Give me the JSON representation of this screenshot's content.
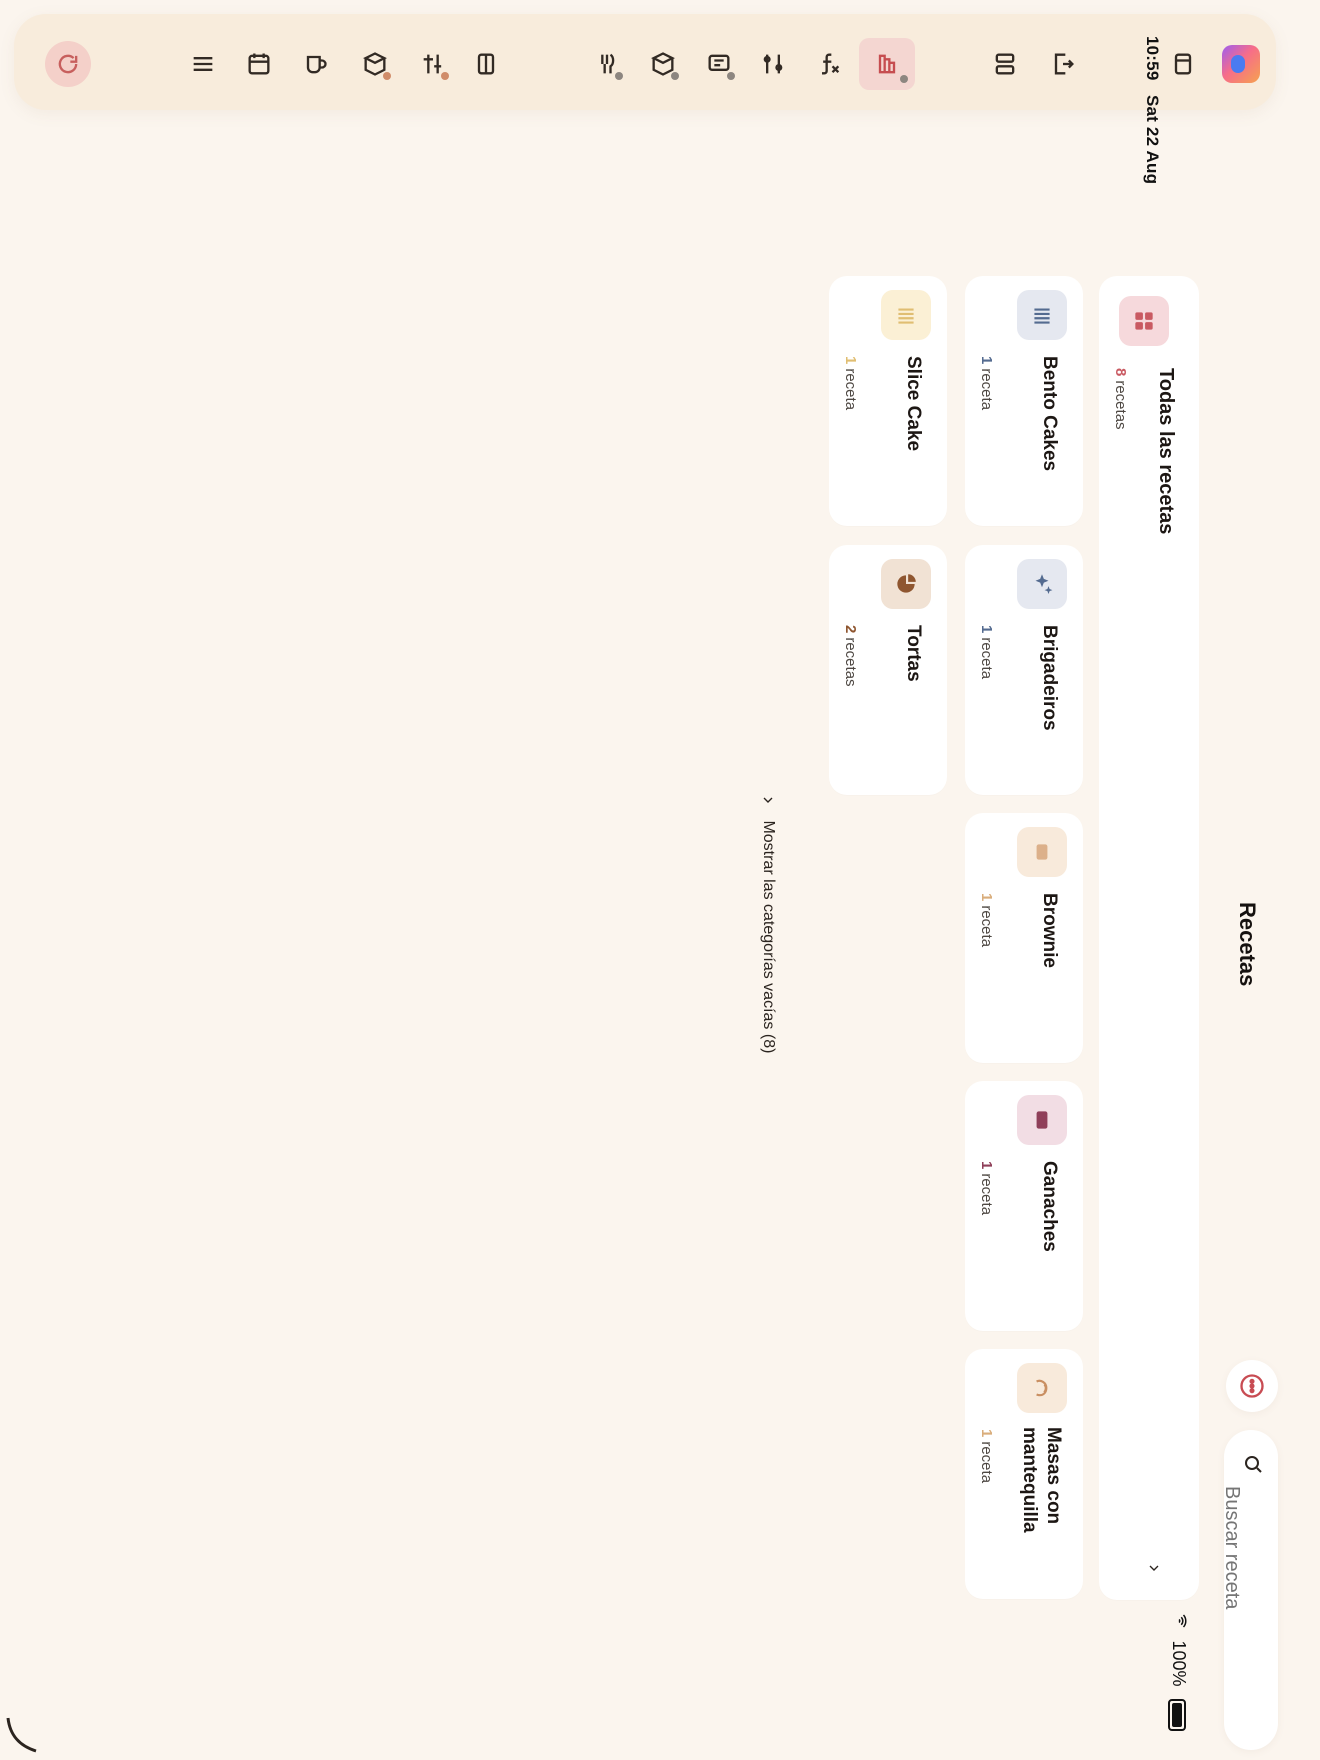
{
  "status_bar": {
    "time": "10:59",
    "date": "Sat 22 Aug",
    "battery": "100%"
  },
  "toolbar": {
    "items": [
      {
        "id": "refresh",
        "icon": "refresh-icon"
      },
      {
        "id": "menu",
        "icon": "menu-icon"
      },
      {
        "id": "calendar",
        "icon": "calendar-icon"
      },
      {
        "id": "cup",
        "icon": "cup-icon"
      },
      {
        "id": "box",
        "icon": "box-icon"
      },
      {
        "id": "tools",
        "icon": "tools-icon"
      },
      {
        "id": "panel",
        "icon": "panel-icon"
      },
      {
        "id": "utensil",
        "icon": "utensil-icon"
      },
      {
        "id": "package",
        "icon": "package-icon"
      },
      {
        "id": "register",
        "icon": "register-icon"
      },
      {
        "id": "filters",
        "icon": "filters-icon"
      },
      {
        "id": "function",
        "icon": "function-icon"
      },
      {
        "id": "recipes",
        "icon": "recipes-icon"
      },
      {
        "id": "rows",
        "icon": "rows-icon"
      },
      {
        "id": "export",
        "icon": "export-icon"
      },
      {
        "id": "cards",
        "icon": "cards-icon"
      },
      {
        "id": "profile",
        "icon": "profile-icon"
      }
    ],
    "active_item": "recipes"
  },
  "page": {
    "title": "Recetas",
    "search": {
      "placeholder": "Buscar receta"
    },
    "more_label": "more"
  },
  "categories": {
    "all": {
      "title": "Todas las recetas",
      "count": "8",
      "unit": "recetas",
      "accent": "#c95a62"
    },
    "items": [
      {
        "name": "Bento Cakes",
        "count": "1",
        "unit": "receta",
        "icon": "layer-cake-icon",
        "bg": "#e5e8f0",
        "accent": "#546b90"
      },
      {
        "name": "Brigadeiros",
        "count": "1",
        "unit": "receta",
        "icon": "sparkles-icon",
        "bg": "#e5e8f0",
        "accent": "#546b90"
      },
      {
        "name": "Brownie",
        "count": "1",
        "unit": "receta",
        "icon": "brownie-icon",
        "bg": "#f8eadb",
        "accent": "#dcb08a"
      },
      {
        "name": "Ganaches",
        "count": "1",
        "unit": "receta",
        "icon": "ganache-icon",
        "bg": "#f2dde4",
        "accent": "#8f3f59"
      },
      {
        "name": "Masas con mantequilla",
        "count": "1",
        "unit": "receta",
        "icon": "dough-icon",
        "bg": "#f8eadb",
        "accent": "#dcb08a"
      },
      {
        "name": "Slice Cake",
        "count": "1",
        "unit": "receta",
        "icon": "slice-cake-icon",
        "bg": "#fbf0d5",
        "accent": "#e9c98b"
      },
      {
        "name": "Tortas",
        "count": "2",
        "unit": "recetas",
        "icon": "pie-icon",
        "bg": "#f1e2d4",
        "accent": "#8f5630"
      }
    ]
  },
  "empty_categories": {
    "label": "Mostrar las categorías vacías (8)"
  }
}
